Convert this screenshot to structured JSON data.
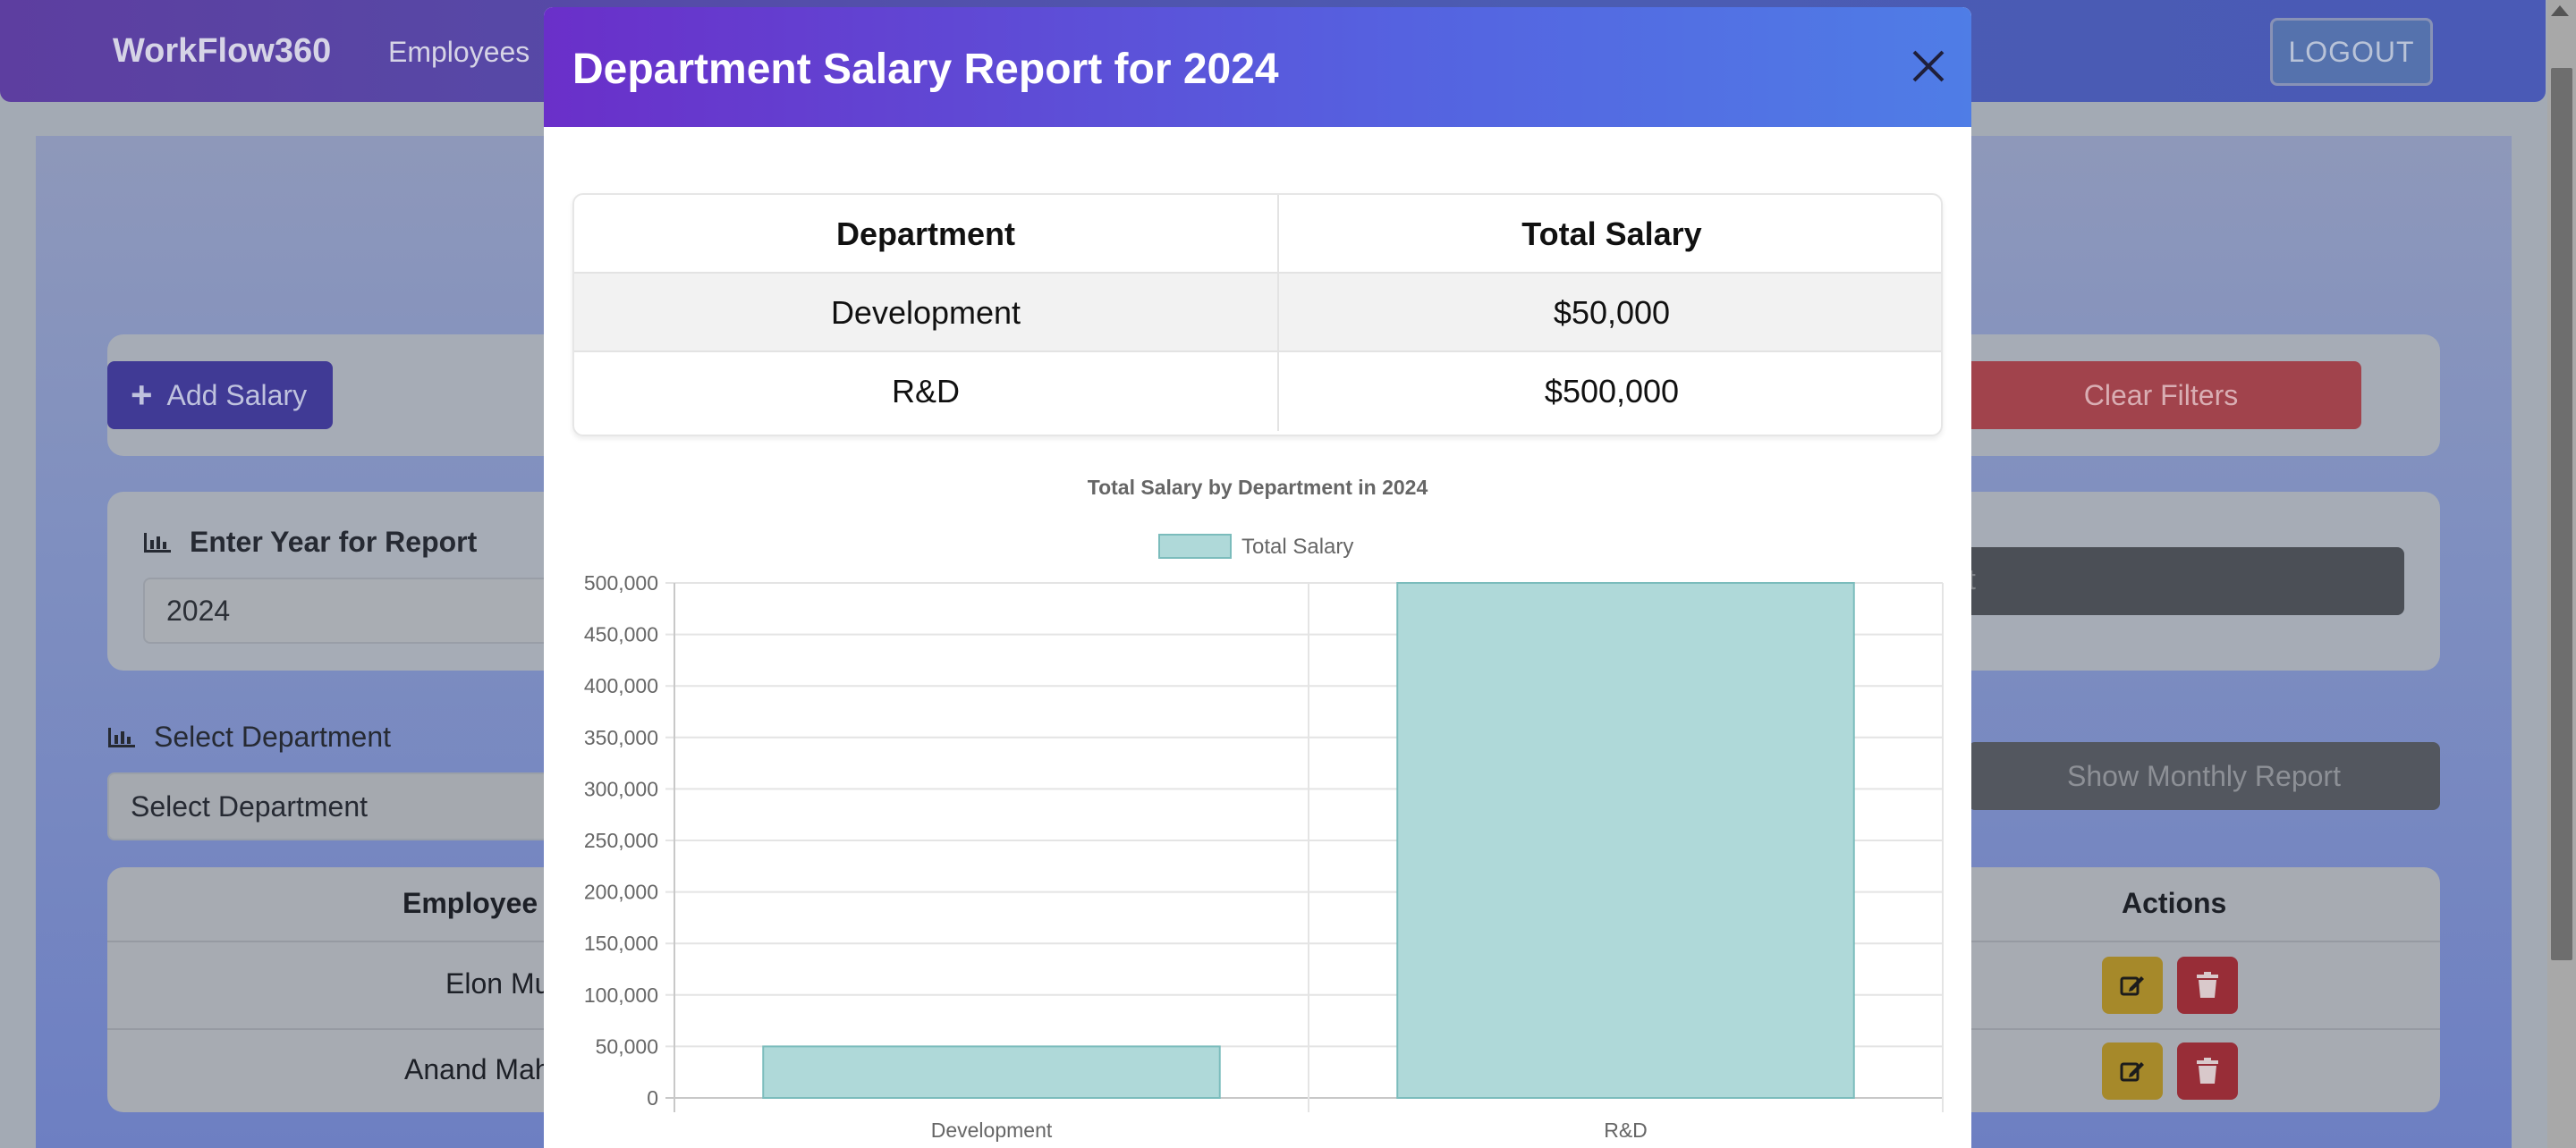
{
  "app": {
    "brand": "WorkFlow360",
    "nav_employees": "Employees",
    "logout_label": "LOGOUT"
  },
  "page": {
    "add_salary_label": "Add Salary",
    "clear_filters_label": "Clear Filters",
    "report_year_label": "Enter Year for Report",
    "report_year_value": "2024",
    "generate_report_partial": "t",
    "select_department_label": "Select Department",
    "select_department_value": "Select Department",
    "show_monthly_label": "Show Monthly Report",
    "table_headers": {
      "employee": "Employee I",
      "actions": "Actions"
    },
    "rows": [
      {
        "employee": "Elon Mu"
      },
      {
        "employee": "Anand Mah"
      }
    ]
  },
  "modal": {
    "title": "Department Salary Report for 2024",
    "table": {
      "headers": [
        "Department",
        "Total Salary"
      ],
      "rows": [
        [
          "Development",
          "$50,000"
        ],
        [
          "R&D",
          "$500,000"
        ]
      ]
    }
  },
  "chart_data": {
    "type": "bar",
    "title": "Total Salary by Department in 2024",
    "categories": [
      "Development",
      "R&D"
    ],
    "series": [
      {
        "name": "Total Salary",
        "values": [
          50000,
          500000
        ],
        "color": "#afd9d9",
        "border": "#7bbcbc"
      }
    ],
    "ylim": [
      0,
      500000
    ],
    "yticks": [
      0,
      50000,
      100000,
      150000,
      200000,
      250000,
      300000,
      350000,
      400000,
      450000,
      500000
    ],
    "ytick_labels": [
      "0",
      "50,000",
      "100,000",
      "150,000",
      "200,000",
      "250,000",
      "300,000",
      "350,000",
      "400,000",
      "450,000",
      "500,000"
    ],
    "legend_position": "top",
    "grid": true
  }
}
